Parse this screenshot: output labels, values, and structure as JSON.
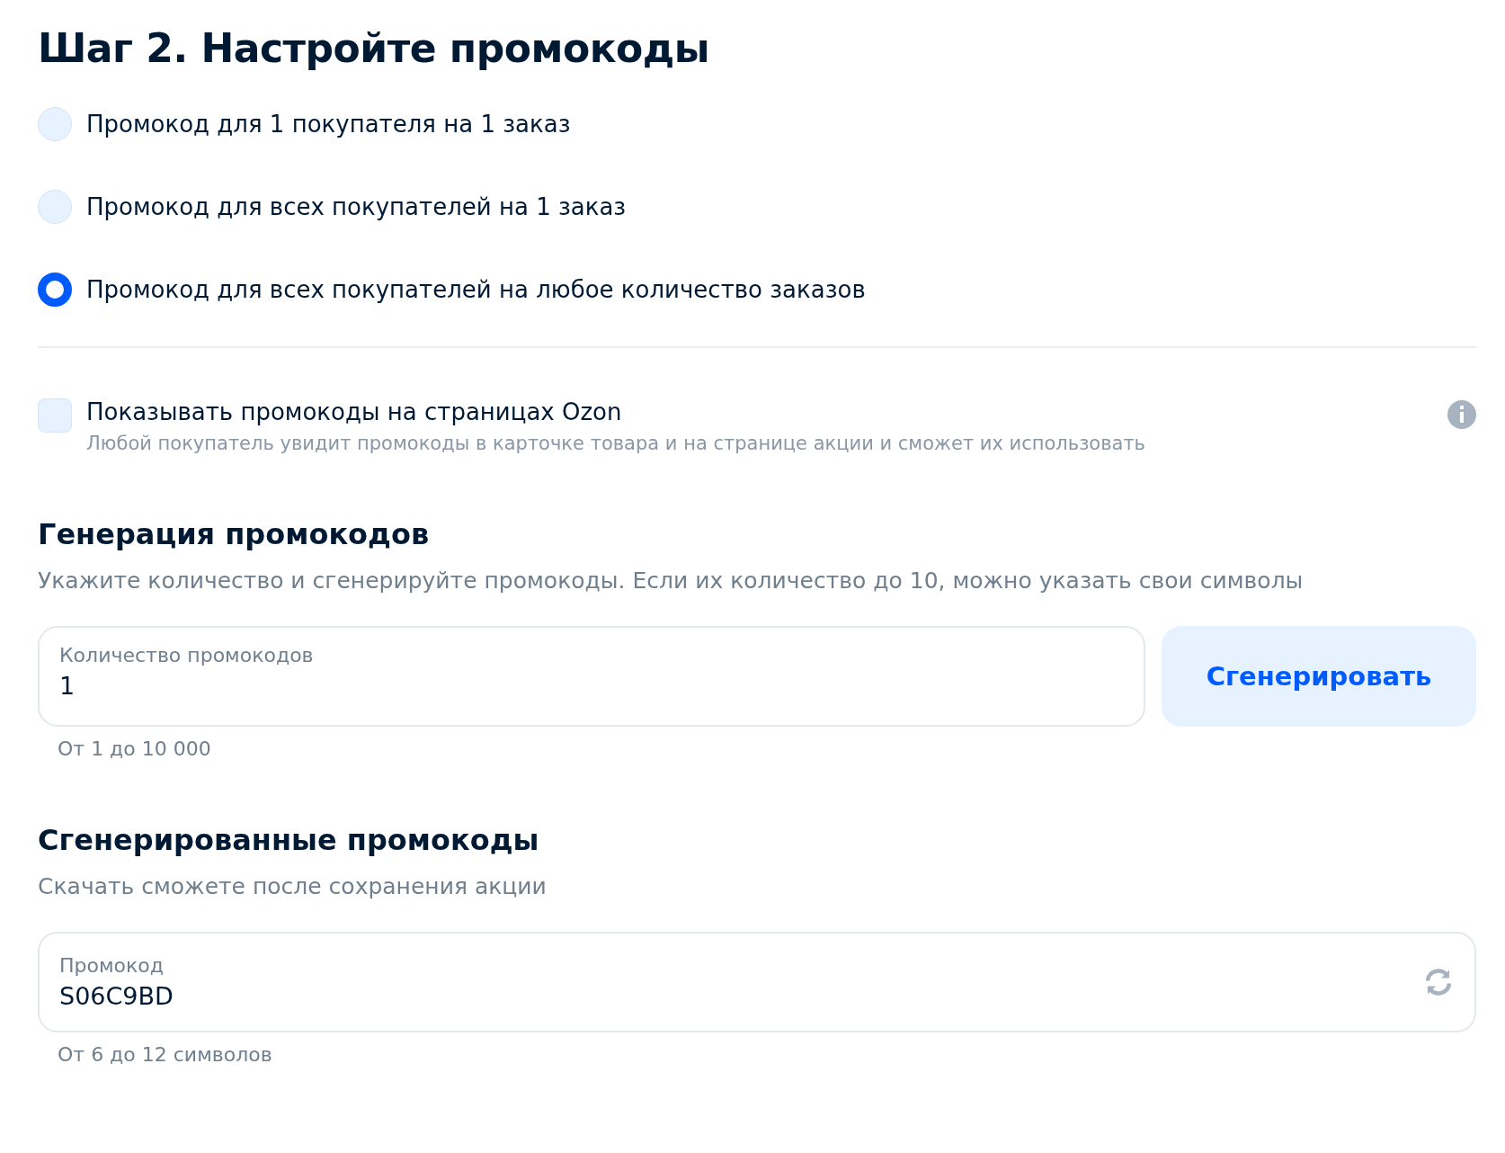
{
  "title": "Шаг 2. Настройте промокоды",
  "promo_types": [
    {
      "label": "Промокод для 1 покупателя на 1 заказ",
      "selected": false
    },
    {
      "label": "Промокод для всех покупателей на 1 заказ",
      "selected": false
    },
    {
      "label": "Промокод для всех покупателей на любое количество заказов",
      "selected": true
    }
  ],
  "show_on_pages": {
    "label": "Показывать промокоды на страницах Ozon",
    "description": "Любой покупатель увидит промокоды в карточке товара и на странице акции и сможет их использовать",
    "checked": false
  },
  "generation": {
    "heading": "Генерация промокодов",
    "description": "Укажите количество и сгенерируйте промокоды. Если их количество до 10, можно указать свои символы",
    "field": {
      "label": "Количество промокодов",
      "value": "1",
      "hint": "От 1 до 10 000"
    },
    "button": "Сгенерировать"
  },
  "generated": {
    "heading": "Сгенерированные промокоды",
    "description": "Скачать сможете после сохранения акции",
    "field": {
      "label": "Промокод",
      "value": "S06C9BD",
      "hint": "От 6 до 12 символов"
    }
  }
}
